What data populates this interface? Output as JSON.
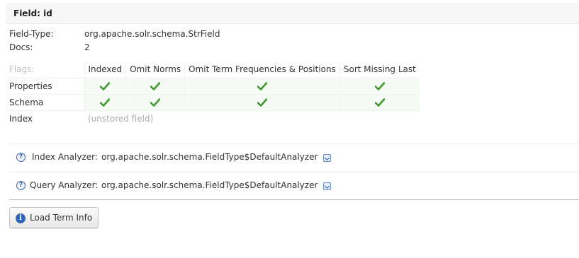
{
  "header": {
    "title": "Field: id"
  },
  "info": {
    "field_type_label": "Field-Type:",
    "field_type_value": "org.apache.solr.schema.StrField",
    "docs_label": "Docs:",
    "docs_value": "2"
  },
  "flags": {
    "corner": "Flags:",
    "columns": [
      "Indexed",
      "Omit Norms",
      "Omit Term Frequencies & Positions",
      "Sort Missing Last"
    ],
    "rows": [
      {
        "label": "Properties",
        "checks": [
          true,
          true,
          true,
          true
        ]
      },
      {
        "label": "Schema",
        "checks": [
          true,
          true,
          true,
          true
        ]
      }
    ],
    "index_label": "Index",
    "index_value": "(unstored field)"
  },
  "analyzers": {
    "index_label": "Index Analyzer:",
    "index_value": "org.apache.solr.schema.FieldType$DefaultAnalyzer",
    "query_label": "Query Analyzer:",
    "query_value": "org.apache.solr.schema.FieldType$DefaultAnalyzer"
  },
  "load_button": {
    "label": "Load Term Info"
  },
  "colors": {
    "check": "#3f9a2e",
    "info_icon": "#2f64b7"
  }
}
